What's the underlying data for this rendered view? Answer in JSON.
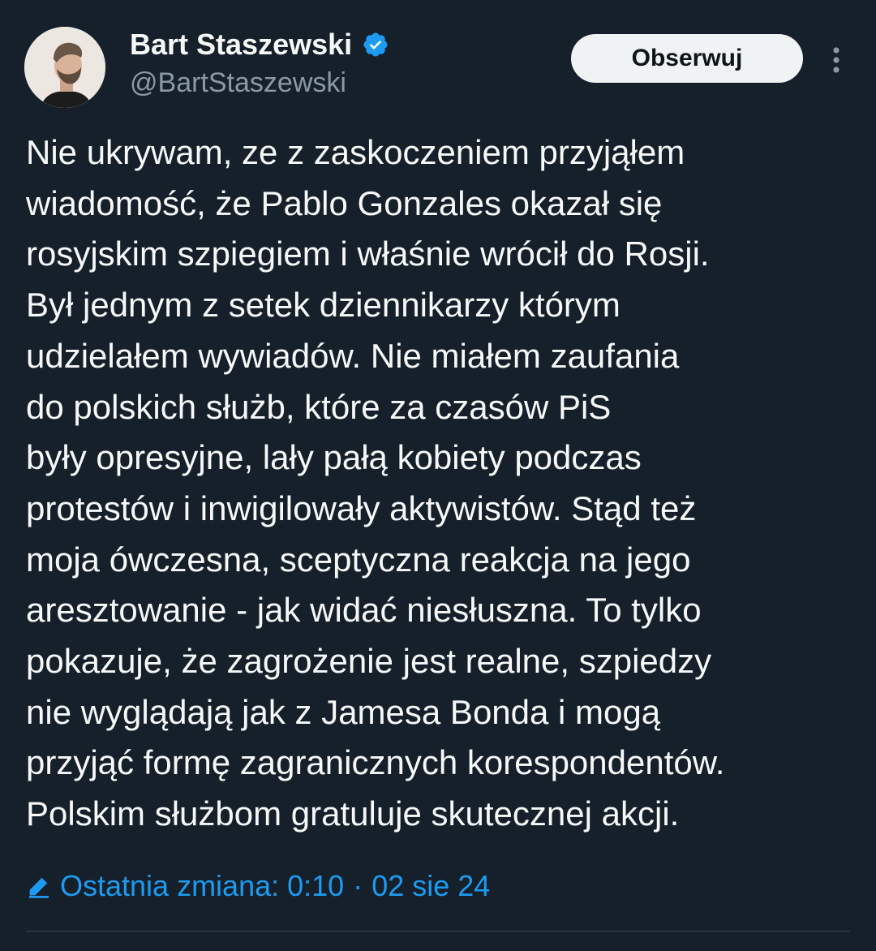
{
  "author": {
    "display_name": "Bart Staszewski",
    "handle": "@BartStaszewski",
    "verified_icon": "verified-badge-icon",
    "avatar_icon": "avatar-photo"
  },
  "actions": {
    "follow_label": "Obserwuj",
    "more_icon": "more-vertical-icon"
  },
  "tweet": {
    "lines": [
      "Nie ukrywam, ze z zaskoczeniem przyjąłem",
      "wiadomość, że Pablo Gonzales okazał się",
      "rosyjskim szpiegiem i właśnie wrócił do Rosji.",
      "Był jednym z setek dziennikarzy którym",
      "udzielałem wywiadów. Nie miałem zaufania",
      "do polskich służb, które za czasów PiS",
      "były opresyjne, lały pałą kobiety podczas",
      "protestów i inwigilowały aktywistów. Stąd też",
      "moja ówczesna, sceptyczna reakcja na jego",
      "aresztowanie - jak widać niesłuszna. To tylko",
      "pokazuje, że zagrożenie jest realne, szpiedzy",
      "nie wyglądają jak z Jamesa Bonda i mogą",
      "przyjąć formę zagranicznych korespondentów.",
      "Polskim służbom gratuluje skutecznej akcji."
    ]
  },
  "meta": {
    "edit_icon": "edit-pencil-icon",
    "edit_label": "Ostatnia zmiana: 0:10",
    "separator": "·",
    "date": "02 sie 24"
  },
  "colors": {
    "background": "#15202b",
    "text": "#f7f9f9",
    "secondary_text": "#8b98a5",
    "accent": "#1d9bf0",
    "button_bg": "#eff3f4",
    "divider": "#38444d"
  }
}
